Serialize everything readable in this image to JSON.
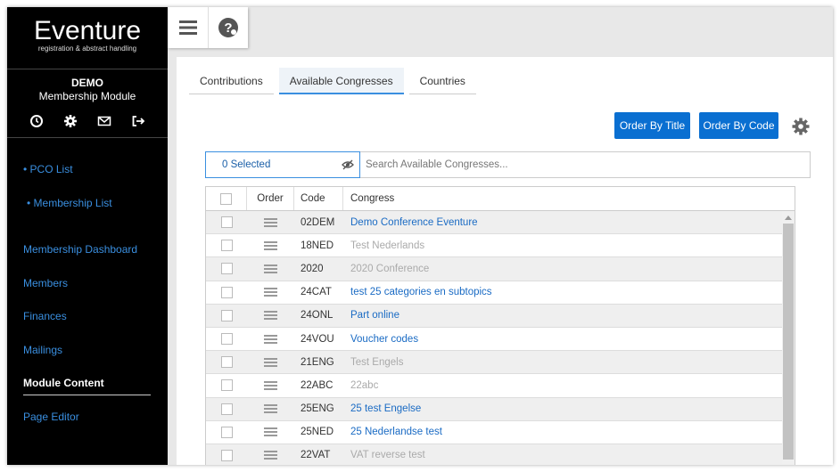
{
  "app": {
    "logo_title": "Eventure",
    "logo_subtitle": "registration & abstract handling",
    "account_name": "DEMO",
    "module": "Membership Module",
    "account_icons": [
      "clock-icon",
      "gear-icon",
      "mail-icon",
      "logout-icon"
    ]
  },
  "nav": {
    "items": [
      {
        "label": "• PCO List"
      },
      {
        "label": "• Membership List"
      },
      {
        "label": "Membership Dashboard"
      },
      {
        "label": "Members"
      },
      {
        "label": "Finances"
      },
      {
        "label": "Mailings"
      },
      {
        "label": "Module Content"
      },
      {
        "label": "Page Editor"
      }
    ],
    "active": "Module Content"
  },
  "topbar": {
    "icons": [
      "hamburger-menu-icon",
      "help-icon"
    ]
  },
  "tabs": [
    {
      "label": "Contributions"
    },
    {
      "label": "Available Congresses"
    },
    {
      "label": "Countries"
    }
  ],
  "active_tab": "Available Congresses",
  "toolbar": {
    "order_by_title": "Order By Title",
    "order_by_code": "Order By Code"
  },
  "selector": {
    "label": "0 Selected"
  },
  "search": {
    "placeholder": "Search Available Congresses..."
  },
  "table": {
    "headers": {
      "order": "Order",
      "code": "Code",
      "congress": "Congress"
    },
    "rows": [
      {
        "code": "02DEM",
        "congress": "Demo Conference Eventure",
        "active": true
      },
      {
        "code": "18NED",
        "congress": "Test Nederlands",
        "active": false
      },
      {
        "code": "2020",
        "congress": "2020 Conference",
        "active": false
      },
      {
        "code": "24CAT",
        "congress": "test 25 categories en subtopics",
        "active": true
      },
      {
        "code": "24ONL",
        "congress": "Part online",
        "active": true
      },
      {
        "code": "24VOU",
        "congress": "Voucher codes",
        "active": true
      },
      {
        "code": "21ENG",
        "congress": "Test Engels",
        "active": false
      },
      {
        "code": "22ABC",
        "congress": "22abc",
        "active": false
      },
      {
        "code": "25ENG",
        "congress": "25 test Engelse",
        "active": true
      },
      {
        "code": "25NED",
        "congress": "25 Nederlandse test",
        "active": true
      },
      {
        "code": "22VAT",
        "congress": "VAT reverse test",
        "active": false
      }
    ]
  },
  "colors": {
    "accent": "#0a6fd1",
    "link": "#1a6bc4",
    "sidebar": "#000000",
    "muted": "#aaaaaa"
  }
}
